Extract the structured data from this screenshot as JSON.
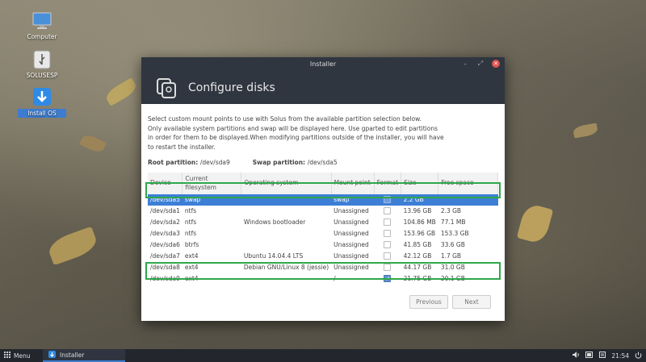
{
  "desktop": {
    "icons": [
      {
        "label": "Computer",
        "icon": "monitor-icon"
      },
      {
        "label": "SOLUSESP",
        "icon": "usb-drive-icon"
      },
      {
        "label": "Install OS",
        "icon": "download-arrow-icon"
      }
    ]
  },
  "window": {
    "title": "Installer",
    "controls": [
      "minimize-icon",
      "maximize-icon",
      "close-icon"
    ]
  },
  "header": {
    "title": "Configure disks",
    "icon": "disks-icon"
  },
  "description": [
    "Select custom mount points to use with Solus from the available partition selection below.",
    "Only available system partitions and swap will be displayed here. Use gparted to edit partitions",
    "in order for them to be displayed.When modifying partitions outside of the installer, you will have",
    "to restart the installer."
  ],
  "partitions": {
    "root_label": "Root partition:",
    "root_value": "/dev/sda9",
    "swap_label": "Swap partition:",
    "swap_value": "/dev/sda5"
  },
  "table": {
    "columns": [
      "Device",
      "Current filesystem",
      "Operating system",
      "Mount point",
      "Format",
      "Size",
      "Free space"
    ],
    "rows": [
      {
        "device": "/dev/sda5",
        "fs": "swap",
        "os": "",
        "mount": "swap",
        "format": false,
        "size": "2.2 GB",
        "free": ""
      },
      {
        "device": "/dev/sda1",
        "fs": "ntfs",
        "os": "",
        "mount": "Unassigned",
        "format": false,
        "size": "13.96 GB",
        "free": "2.3 GB"
      },
      {
        "device": "/dev/sda2",
        "fs": "ntfs",
        "os": "Windows bootloader",
        "mount": "Unassigned",
        "format": false,
        "size": "104.86 MB",
        "free": "77.1 MB"
      },
      {
        "device": "/dev/sda3",
        "fs": "ntfs",
        "os": "",
        "mount": "Unassigned",
        "format": false,
        "size": "153.96 GB",
        "free": "153.3 GB"
      },
      {
        "device": "/dev/sda6",
        "fs": "btrfs",
        "os": "",
        "mount": "Unassigned",
        "format": false,
        "size": "41.85 GB",
        "free": "33.6 GB"
      },
      {
        "device": "/dev/sda7",
        "fs": "ext4",
        "os": "Ubuntu 14.04.4 LTS",
        "mount": "Unassigned",
        "format": false,
        "size": "42.12 GB",
        "free": "1.7 GB"
      },
      {
        "device": "/dev/sda8",
        "fs": "ext4",
        "os": "Debian GNU/Linux 8 (jessie)",
        "mount": "Unassigned",
        "format": false,
        "size": "44.17 GB",
        "free": "31.0 GB"
      },
      {
        "device": "/dev/sda9",
        "fs": "ext4",
        "os": "",
        "mount": "/",
        "format": true,
        "size": "21.75 GB",
        "free": "20.1 GB"
      }
    ]
  },
  "buttons": {
    "previous": "Previous",
    "next": "Next"
  },
  "taskbar": {
    "menu_label": "Menu",
    "task_label": "Installer",
    "clock": "21:54",
    "tray_icons": [
      "volume-icon",
      "battery-icon",
      "notifications-icon",
      "power-icon"
    ]
  },
  "colors": {
    "selection": "#3d7fd6",
    "highlight_box": "#2ea84a",
    "close_button": "#e0524d",
    "header_bg": "#2f3640"
  }
}
